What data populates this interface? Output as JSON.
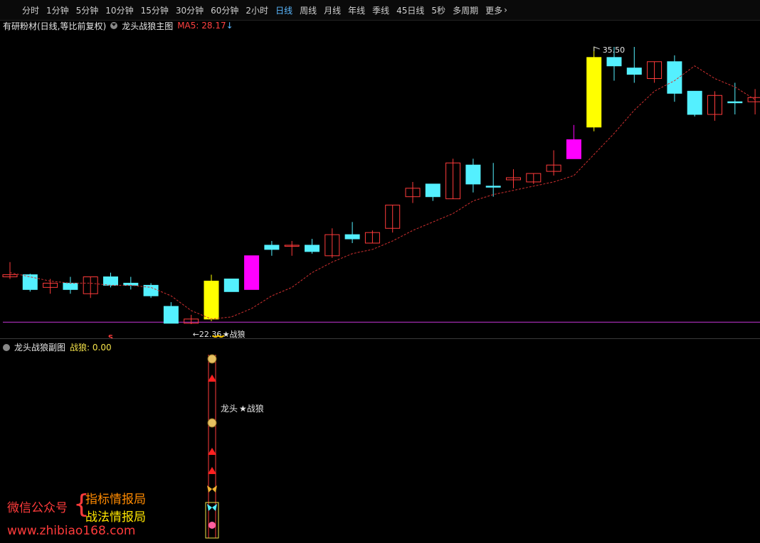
{
  "toolbar": {
    "items": [
      "分时",
      "1分钟",
      "5分钟",
      "10分钟",
      "15分钟",
      "30分钟",
      "60分钟",
      "2小时",
      "日线",
      "周线",
      "月线",
      "年线",
      "季线",
      "45日线",
      "5秒",
      "多周期",
      "更多"
    ],
    "active": "日线",
    "more_icon": "chevron-right-icon"
  },
  "info": {
    "stock": "有研粉材(日线,等比前复权)",
    "indicator_name": "龙头战狼主图",
    "ma_label": "MA5: 28.17",
    "arrow": "↓"
  },
  "annotations": {
    "high_label": "35.50",
    "low_label": "←22.36",
    "star_label": "★战狼",
    "s_mark": "S"
  },
  "sub": {
    "name": "龙头战狼副图",
    "value_label": "战狼: 0.00",
    "signal_text": "龙头",
    "signal_star": "★战狼"
  },
  "watermark": {
    "wechat": "微信公众号",
    "brace": "{",
    "line1": "指标情报局",
    "line2": "战法情报局",
    "url": "www.zhibiao168.com"
  },
  "colors": {
    "up": "#ff3b3b",
    "down": "#54f0ff",
    "signal_yellow": "#ffff00",
    "signal_magenta": "#ff00ff",
    "support_line": "#b030c0",
    "ma": "#d03030"
  },
  "chart_data": {
    "type": "candlestick",
    "price_labels": {
      "high": 35.5,
      "low": 22.36
    },
    "support_level": 22.45,
    "candles": [
      {
        "o": 24.6,
        "c": 24.7,
        "h": 25.3,
        "l": 24.5,
        "k": "up"
      },
      {
        "o": 24.7,
        "c": 24.0,
        "h": 24.75,
        "l": 23.9,
        "k": "down"
      },
      {
        "o": 24.1,
        "c": 24.3,
        "h": 24.5,
        "l": 23.8,
        "k": "up"
      },
      {
        "o": 24.3,
        "c": 24.0,
        "h": 24.6,
        "l": 23.8,
        "k": "down"
      },
      {
        "o": 23.8,
        "c": 24.6,
        "h": 24.6,
        "l": 23.6,
        "k": "up"
      },
      {
        "o": 24.6,
        "c": 24.2,
        "h": 24.8,
        "l": 24.1,
        "k": "down"
      },
      {
        "o": 24.3,
        "c": 24.2,
        "h": 24.6,
        "l": 24.0,
        "k": "down"
      },
      {
        "o": 24.2,
        "c": 23.7,
        "h": 24.3,
        "l": 23.6,
        "k": "down"
      },
      {
        "o": 23.2,
        "c": 22.4,
        "h": 23.4,
        "l": 22.4,
        "k": "down"
      },
      {
        "o": 22.4,
        "c": 22.6,
        "h": 22.8,
        "l": 22.36,
        "k": "up"
      },
      {
        "o": 22.6,
        "c": 24.4,
        "h": 24.7,
        "l": 22.5,
        "k": "yellow"
      },
      {
        "o": 24.5,
        "c": 23.9,
        "h": 24.5,
        "l": 23.9,
        "k": "down"
      },
      {
        "o": 24.0,
        "c": 25.6,
        "h": 25.6,
        "l": 24.0,
        "k": "magenta"
      },
      {
        "o": 26.1,
        "c": 25.9,
        "h": 26.3,
        "l": 25.6,
        "k": "down"
      },
      {
        "o": 26.1,
        "c": 26.1,
        "h": 26.3,
        "l": 25.6,
        "k": "up"
      },
      {
        "o": 26.1,
        "c": 25.8,
        "h": 26.4,
        "l": 25.7,
        "k": "down"
      },
      {
        "o": 25.6,
        "c": 26.6,
        "h": 26.9,
        "l": 25.5,
        "k": "up"
      },
      {
        "o": 26.6,
        "c": 26.4,
        "h": 27.2,
        "l": 26.2,
        "k": "down"
      },
      {
        "o": 26.2,
        "c": 26.7,
        "h": 26.8,
        "l": 26.2,
        "k": "up"
      },
      {
        "o": 26.9,
        "c": 28.0,
        "h": 28.0,
        "l": 26.7,
        "k": "up"
      },
      {
        "o": 28.4,
        "c": 28.8,
        "h": 29.1,
        "l": 28.1,
        "k": "up"
      },
      {
        "o": 29.0,
        "c": 28.4,
        "h": 29.0,
        "l": 28.2,
        "k": "down"
      },
      {
        "o": 28.3,
        "c": 30.0,
        "h": 30.2,
        "l": 28.3,
        "k": "up"
      },
      {
        "o": 29.9,
        "c": 29.0,
        "h": 30.2,
        "l": 28.6,
        "k": "down"
      },
      {
        "o": 28.9,
        "c": 28.9,
        "h": 30.0,
        "l": 28.4,
        "k": "down"
      },
      {
        "o": 29.2,
        "c": 29.3,
        "h": 29.7,
        "l": 28.8,
        "k": "up"
      },
      {
        "o": 29.1,
        "c": 29.5,
        "h": 29.5,
        "l": 29.0,
        "k": "up"
      },
      {
        "o": 29.6,
        "c": 29.9,
        "h": 30.6,
        "l": 29.4,
        "k": "up"
      },
      {
        "o": 30.2,
        "c": 31.1,
        "h": 31.8,
        "l": 30.2,
        "k": "magenta"
      },
      {
        "o": 31.7,
        "c": 35.0,
        "h": 35.5,
        "l": 31.5,
        "k": "yellow"
      },
      {
        "o": 35.0,
        "c": 34.6,
        "h": 35.5,
        "l": 33.9,
        "k": "down"
      },
      {
        "o": 34.5,
        "c": 34.2,
        "h": 35.5,
        "l": 33.8,
        "k": "down"
      },
      {
        "o": 34.0,
        "c": 34.8,
        "h": 34.8,
        "l": 33.8,
        "k": "up"
      },
      {
        "o": 34.8,
        "c": 33.3,
        "h": 35.1,
        "l": 32.9,
        "k": "down"
      },
      {
        "o": 33.4,
        "c": 32.3,
        "h": 33.4,
        "l": 32.2,
        "k": "down"
      },
      {
        "o": 32.3,
        "c": 33.2,
        "h": 33.4,
        "l": 32.0,
        "k": "up"
      },
      {
        "o": 32.9,
        "c": 32.9,
        "h": 33.8,
        "l": 32.3,
        "k": "down"
      },
      {
        "o": 32.9,
        "c": 33.1,
        "h": 33.5,
        "l": 32.3,
        "k": "up"
      }
    ],
    "ma5": [
      24.8,
      24.6,
      24.4,
      24.3,
      24.3,
      24.2,
      24.2,
      24.1,
      23.7,
      23.0,
      22.6,
      22.7,
      23.1,
      23.7,
      24.1,
      24.8,
      25.3,
      25.7,
      25.9,
      26.3,
      26.8,
      27.2,
      27.6,
      28.2,
      28.5,
      28.7,
      28.9,
      29.1,
      29.4,
      30.4,
      31.4,
      32.5,
      33.4,
      33.9,
      34.6,
      34.0,
      33.6,
      33.0
    ]
  }
}
